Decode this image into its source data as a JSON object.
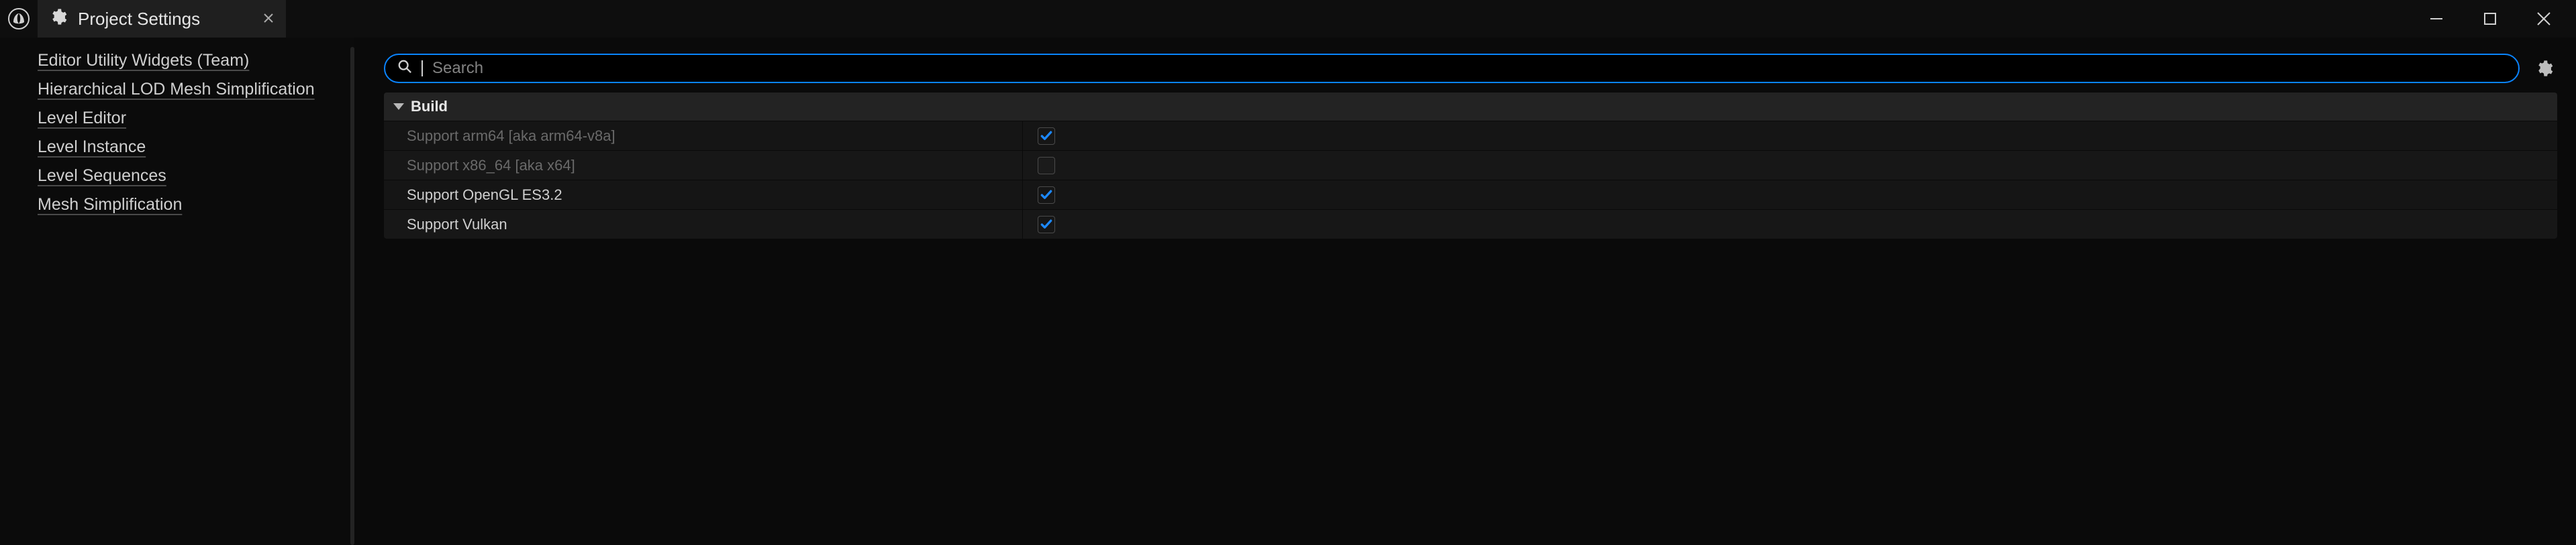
{
  "window": {
    "tab_title": "Project Settings"
  },
  "sidebar": {
    "items": [
      {
        "label": "Editor Utility Widgets (Team)"
      },
      {
        "label": "Hierarchical LOD Mesh Simplification"
      },
      {
        "label": "Level Editor"
      },
      {
        "label": "Level Instance"
      },
      {
        "label": "Level Sequences"
      },
      {
        "label": "Mesh Simplification"
      }
    ]
  },
  "search": {
    "placeholder": "Search"
  },
  "section": {
    "title": "Build",
    "rows": [
      {
        "label": "Support arm64 [aka arm64-v8a]",
        "checked": true,
        "dim": true
      },
      {
        "label": "Support x86_64 [aka x64]",
        "checked": false,
        "dim": true
      },
      {
        "label": "Support OpenGL ES3.2",
        "checked": true,
        "dim": false
      },
      {
        "label": "Support Vulkan",
        "checked": true,
        "dim": false
      }
    ]
  },
  "colors": {
    "accent": "#0a84ff",
    "check": "#1d89ff"
  }
}
